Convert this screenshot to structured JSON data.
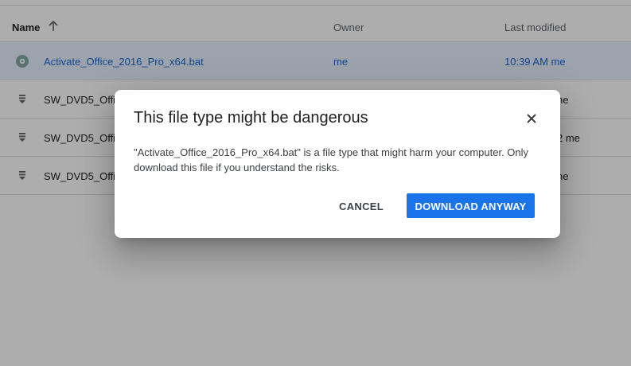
{
  "table": {
    "headers": {
      "name": "Name",
      "owner": "Owner",
      "last_modified": "Last modified"
    },
    "rows": [
      {
        "name": "Activate_Office_2016_Pro_x64.bat",
        "owner": "me",
        "modified": "10:39 AM  me",
        "icon": "gear-file-icon",
        "selected": true
      },
      {
        "name": "SW_DVD5_Offic",
        "owner": "",
        "modified": "ne",
        "icon": "archive-file-icon",
        "selected": false
      },
      {
        "name": "SW_DVD5_Offic",
        "owner": "",
        "modified": "2 me",
        "icon": "archive-file-icon",
        "selected": false
      },
      {
        "name": "SW_DVD5_Offic",
        "owner": "",
        "modified": "ne",
        "icon": "archive-file-icon",
        "selected": false
      }
    ]
  },
  "dialog": {
    "title": "This file type might be dangerous",
    "body": "\"Activate_Office_2016_Pro_x64.bat\" is a file type that might harm your computer. Only download this file if you understand the risks.",
    "cancel_label": "CANCEL",
    "download_label": "DOWNLOAD ANYWAY",
    "close_icon": "close-icon"
  },
  "colors": {
    "accent": "#1a73e8",
    "selected_row_bg": "#e8f0fe",
    "selected_text": "#1967d2"
  }
}
